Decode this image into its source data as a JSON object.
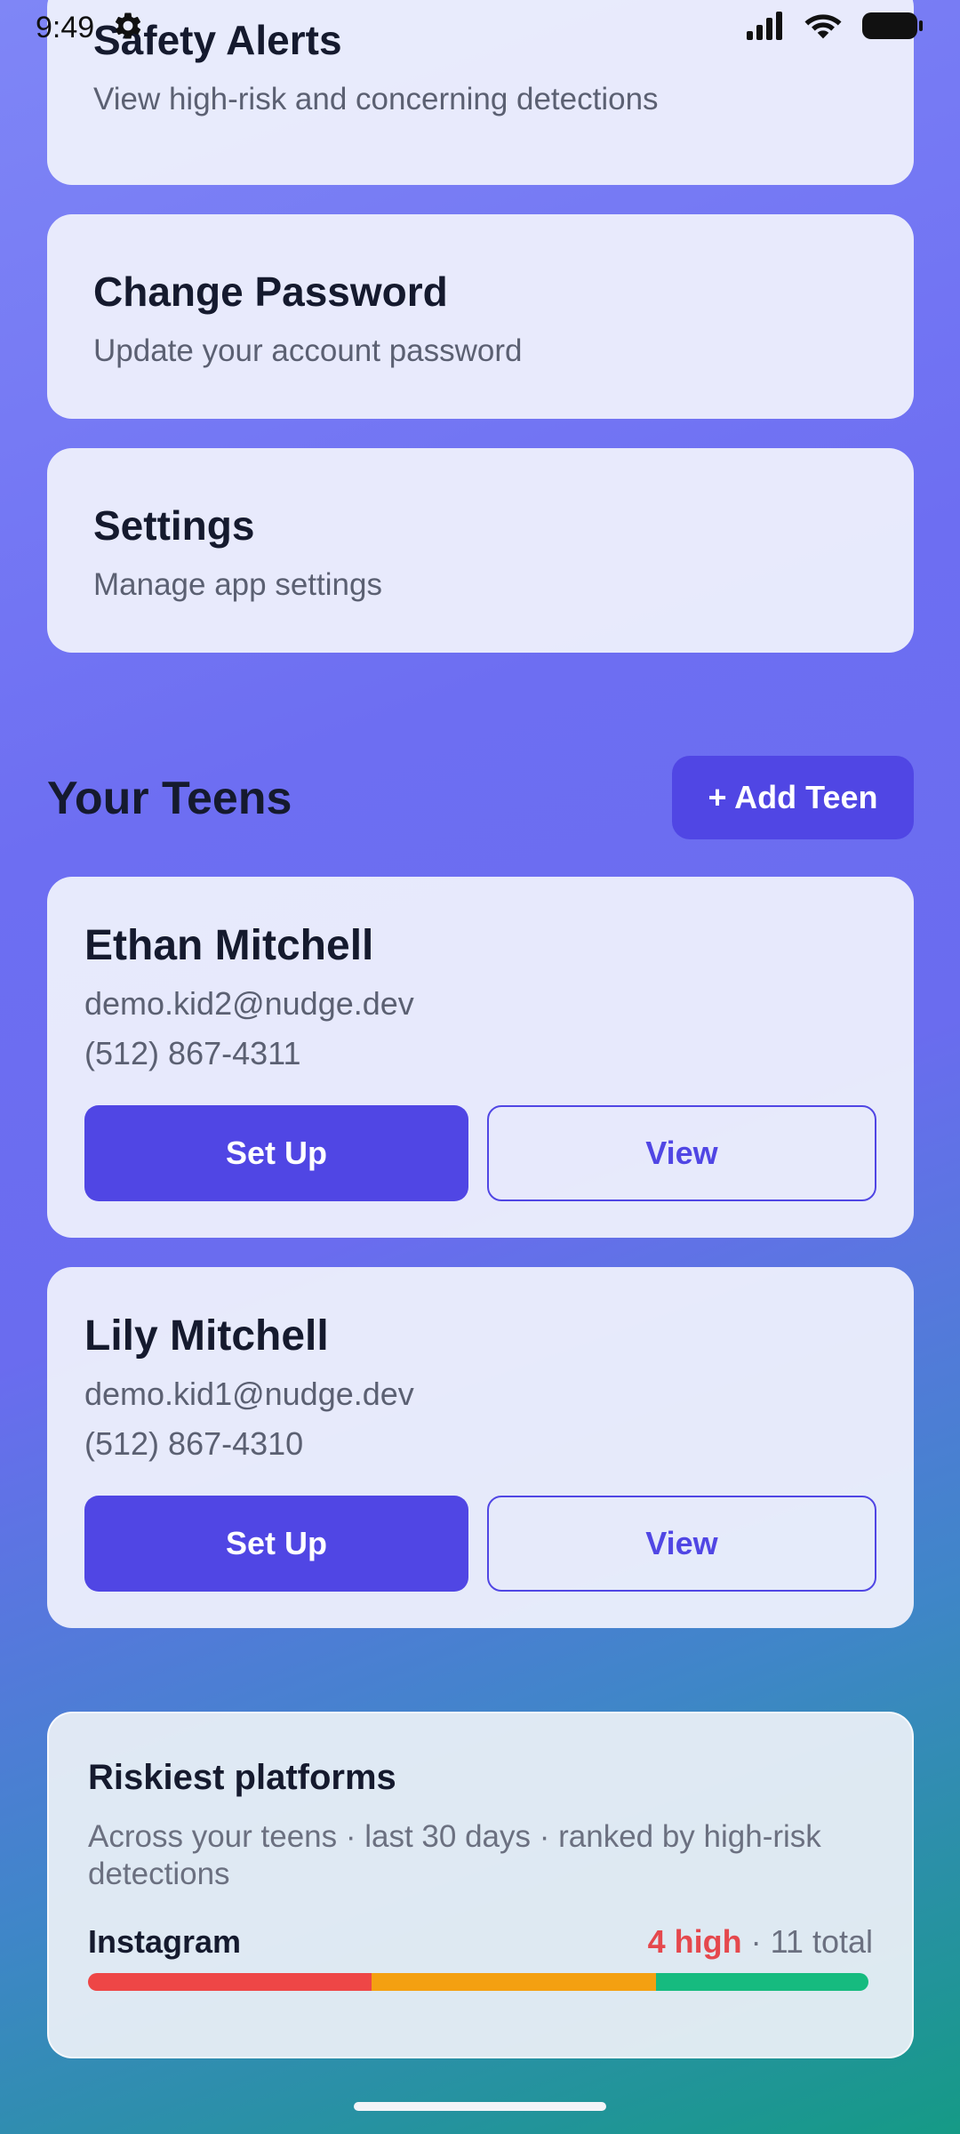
{
  "status_bar": {
    "time": "9:49",
    "icons": [
      "gear-icon",
      "signal-icon",
      "wifi-icon",
      "battery-icon"
    ]
  },
  "menu": {
    "safety_alerts": {
      "title": "Safety Alerts",
      "subtitle": "View high-risk and concerning detections"
    },
    "change_password": {
      "title": "Change Password",
      "subtitle": "Update your account password"
    },
    "settings": {
      "title": "Settings",
      "subtitle": "Manage app settings"
    }
  },
  "teens_section": {
    "title": "Your Teens",
    "add_label": "+ Add Teen",
    "teens": [
      {
        "name": "Ethan Mitchell",
        "email": "demo.kid2@nudge.dev",
        "phone": "(512) 867-4311",
        "setup_label": "Set Up",
        "view_label": "View"
      },
      {
        "name": "Lily Mitchell",
        "email": "demo.kid1@nudge.dev",
        "phone": "(512) 867-4310",
        "setup_label": "Set Up",
        "view_label": "View"
      }
    ]
  },
  "riskiest_platforms": {
    "title": "Riskiest platforms",
    "subtitle": "Across your teens · last 30 days · ranked by high-risk detections",
    "platforms": [
      {
        "name": "Instagram",
        "high_label": "4 high",
        "total_label": " · 11 total",
        "high": 4,
        "total": 11,
        "segments": [
          {
            "level": "high",
            "color": "#ee4646",
            "count": 4
          },
          {
            "level": "medium",
            "color": "#f4a011",
            "count": 4
          },
          {
            "level": "low",
            "color": "#16bb7f",
            "count": 3
          }
        ]
      }
    ]
  },
  "colors": {
    "accent": "#5046e4",
    "high_risk": "#e5484d",
    "medium_risk": "#f4a011",
    "low_risk": "#16bb7f"
  }
}
